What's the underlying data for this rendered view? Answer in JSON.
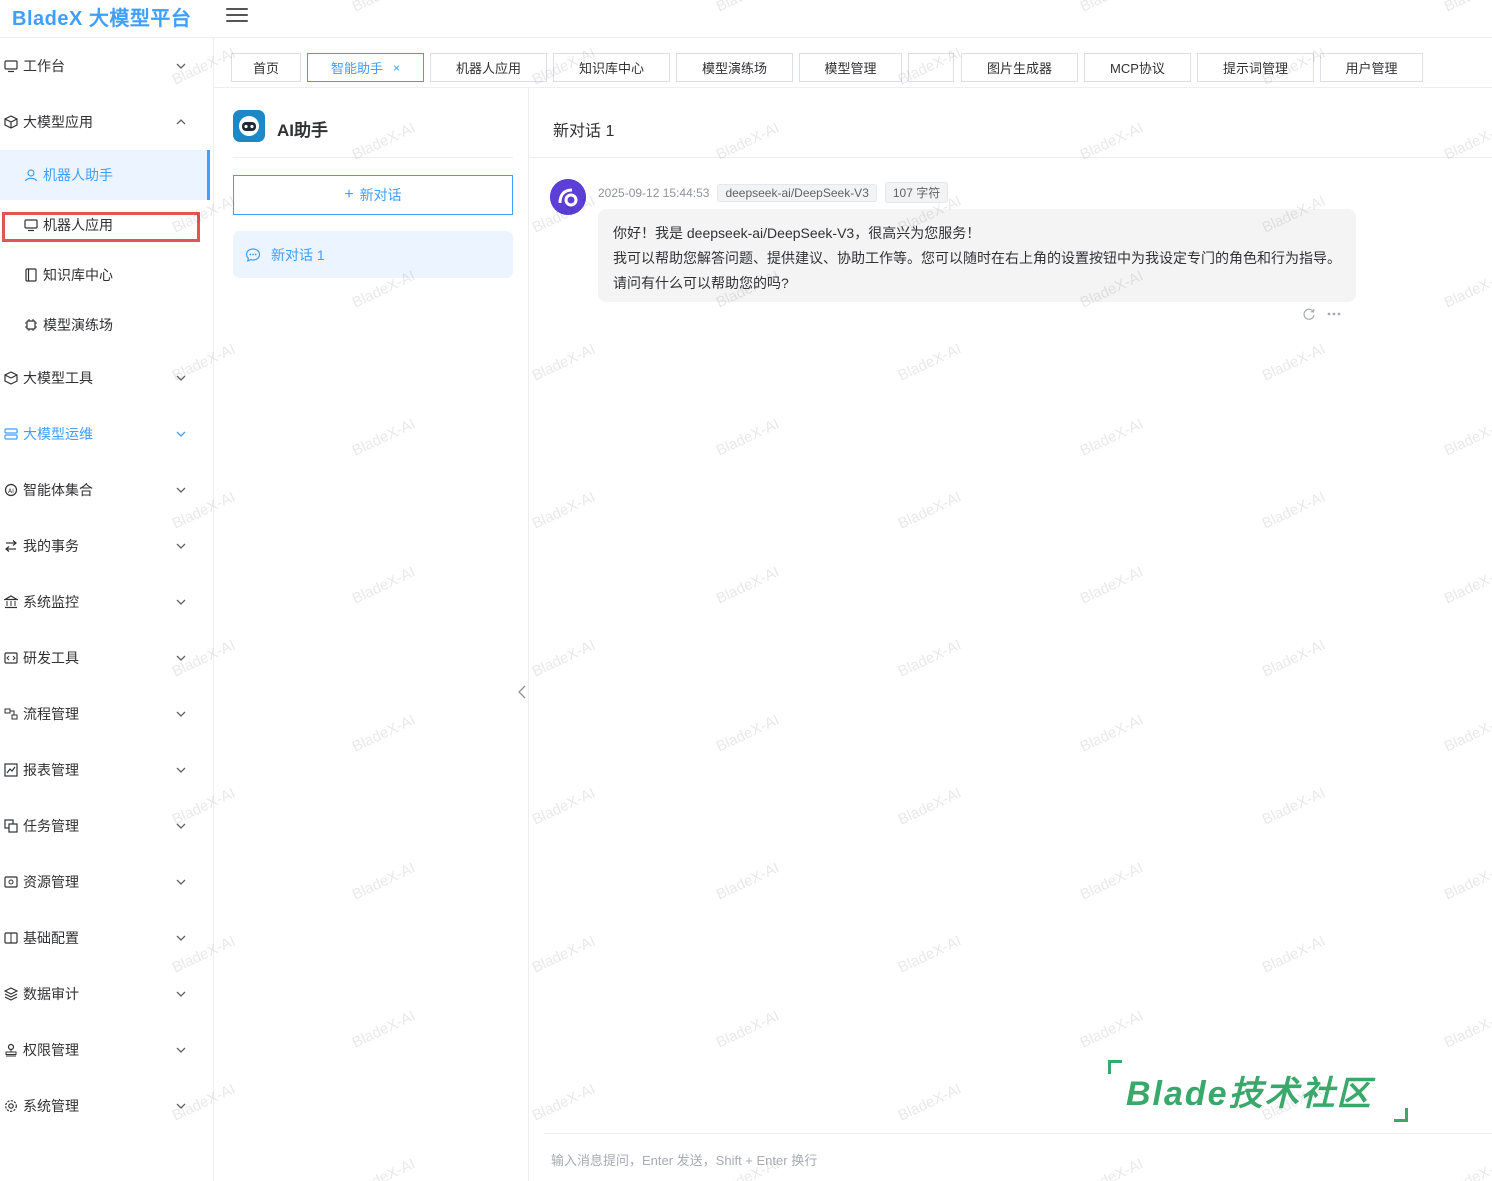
{
  "header": {
    "brand": "BladeX 大模型平台"
  },
  "sidebar": {
    "items": [
      {
        "label": "工作台",
        "icon": "monitor-icon",
        "expanded": false
      },
      {
        "label": "大模型应用",
        "icon": "cube-icon",
        "expanded": true
      },
      {
        "label": "机器人助手",
        "icon": "user-icon",
        "sub": true,
        "active": true
      },
      {
        "label": "机器人应用",
        "icon": "monitor-icon",
        "sub": true,
        "highlighted": true
      },
      {
        "label": "知识库中心",
        "icon": "book-icon",
        "sub": true
      },
      {
        "label": "模型演练场",
        "icon": "chip-icon",
        "sub": true
      },
      {
        "label": "大模型工具",
        "icon": "box-icon",
        "expanded": false
      },
      {
        "label": "大模型运维",
        "icon": "server-icon",
        "expanded": false,
        "accent": true
      },
      {
        "label": "智能体集合",
        "icon": "ai-agent-icon",
        "expanded": false
      },
      {
        "label": "我的事务",
        "icon": "transfer-icon",
        "expanded": false
      },
      {
        "label": "系统监控",
        "icon": "bank-icon",
        "expanded": false
      },
      {
        "label": "研发工具",
        "icon": "code-icon",
        "expanded": false
      },
      {
        "label": "流程管理",
        "icon": "flow-icon",
        "expanded": false
      },
      {
        "label": "报表管理",
        "icon": "chart-icon",
        "expanded": false
      },
      {
        "label": "任务管理",
        "icon": "copy-icon",
        "expanded": false
      },
      {
        "label": "资源管理",
        "icon": "storage-icon",
        "expanded": false
      },
      {
        "label": "基础配置",
        "icon": "manual-icon",
        "expanded": false
      },
      {
        "label": "数据审计",
        "icon": "layers-icon",
        "expanded": false
      },
      {
        "label": "权限管理",
        "icon": "stamp-icon",
        "expanded": false
      },
      {
        "label": "系统管理",
        "icon": "gear-icon",
        "expanded": false
      }
    ]
  },
  "tabs": [
    {
      "label": "首页",
      "active": false
    },
    {
      "label": "智能助手",
      "active": true,
      "closable": true,
      "close": "×"
    },
    {
      "label": "机器人应用",
      "active": false
    },
    {
      "label": "知识库中心",
      "active": false
    },
    {
      "label": "模型演练场",
      "active": false
    },
    {
      "label": "模型管理",
      "active": false
    },
    {
      "label": "",
      "active": false
    },
    {
      "label": "图片生成器",
      "active": false
    },
    {
      "label": "MCP协议",
      "active": false
    },
    {
      "label": "提示词管理",
      "active": false
    },
    {
      "label": "用户管理",
      "active": false
    }
  ],
  "conversation_panel": {
    "title": "AI助手",
    "new_chat_plus": "+",
    "new_chat_label": "新对话",
    "conversations": [
      {
        "label": "新对话 1",
        "active": true
      }
    ]
  },
  "chat": {
    "title": "新对话 1",
    "messages": [
      {
        "timestamp": "2025-09-12 15:44:53",
        "model": "deepseek-ai/DeepSeek-V3",
        "char_count": "107 字符",
        "lines": [
          "你好！我是 deepseek-ai/DeepSeek-V3，很高兴为您服务！",
          "我可以帮助您解答问题、提供建议、协助工作等。您可以随时在右上角的设置按钮中为我设定专门的角色和行为指导。",
          "请问有什么可以帮助您的吗?"
        ]
      }
    ],
    "input_placeholder": "输入消息提问，Enter 发送，Shift + Enter 换行"
  },
  "watermark_text": "BladeX-AI",
  "stamp_text": "Blade技术社区",
  "colors": {
    "accent": "#409eff",
    "highlight_border": "#e05555",
    "stamp": "#3aa86b"
  }
}
